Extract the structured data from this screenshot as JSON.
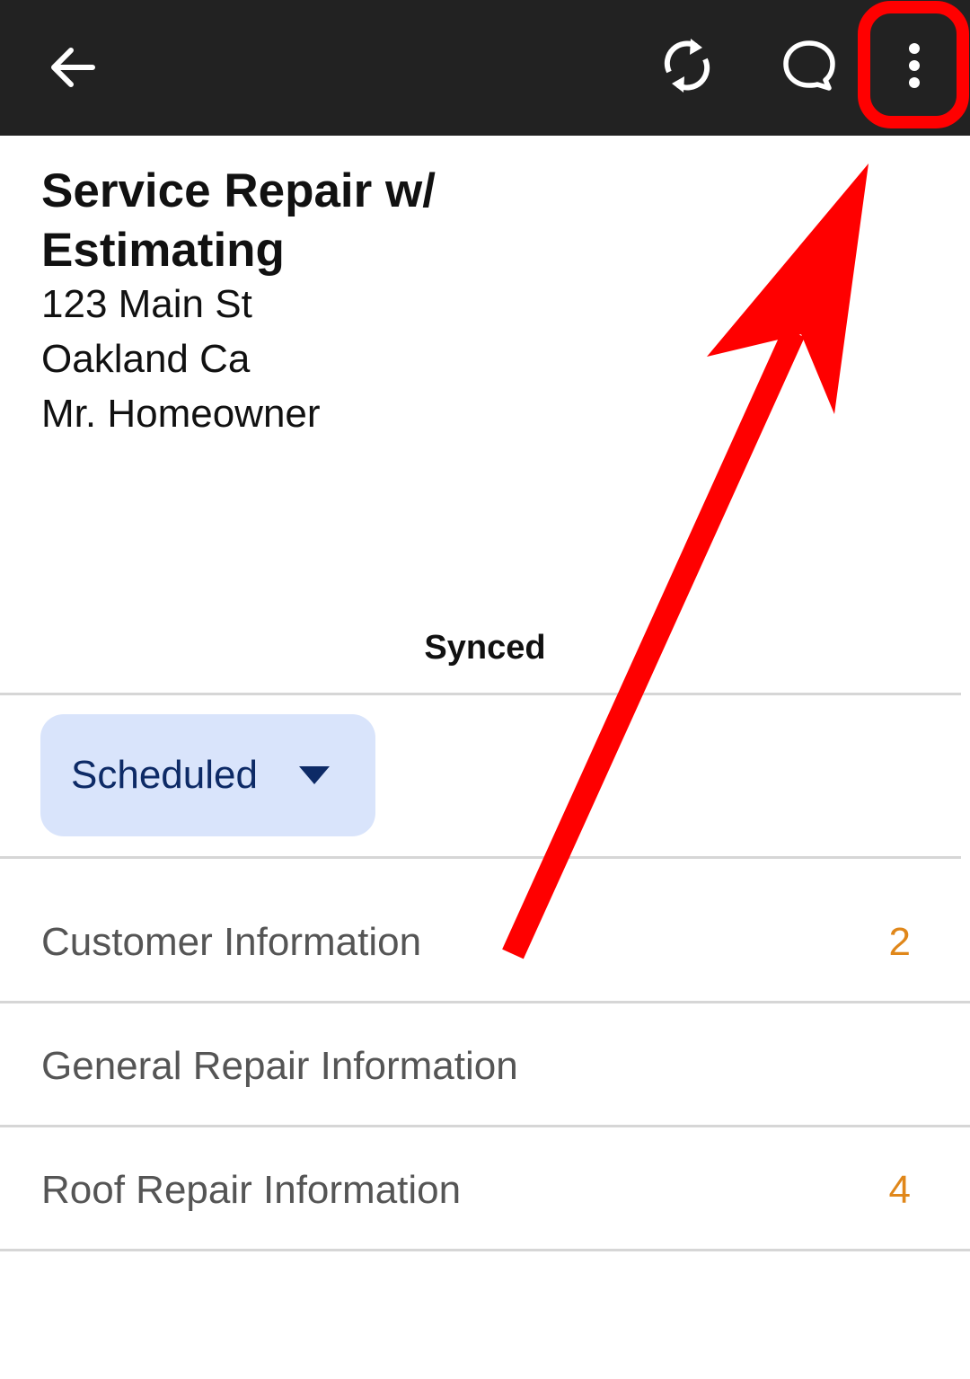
{
  "toolbar": {
    "back_icon": "arrow-left-icon",
    "sync_icon": "sync-icon",
    "chat_icon": "chat-bubble-icon",
    "more_icon": "more-vertical-icon",
    "background": "#222222"
  },
  "job": {
    "title": "Service Repair w/ Estimating",
    "address_line1": "123 Main St",
    "address_line2": "Oakland Ca",
    "customer": "Mr. Homeowner"
  },
  "sync_status": "Synced",
  "status_dropdown": {
    "selected": "Scheduled",
    "background": "#d9e4fb",
    "text_color": "#0d2a66"
  },
  "sections": [
    {
      "label": "Customer Information",
      "count": "2"
    },
    {
      "label": "General Repair Information",
      "count": ""
    },
    {
      "label": "Roof Repair Information",
      "count": "4"
    }
  ],
  "colors": {
    "count_accent": "#e0871a",
    "annotation": "#ff0000"
  }
}
